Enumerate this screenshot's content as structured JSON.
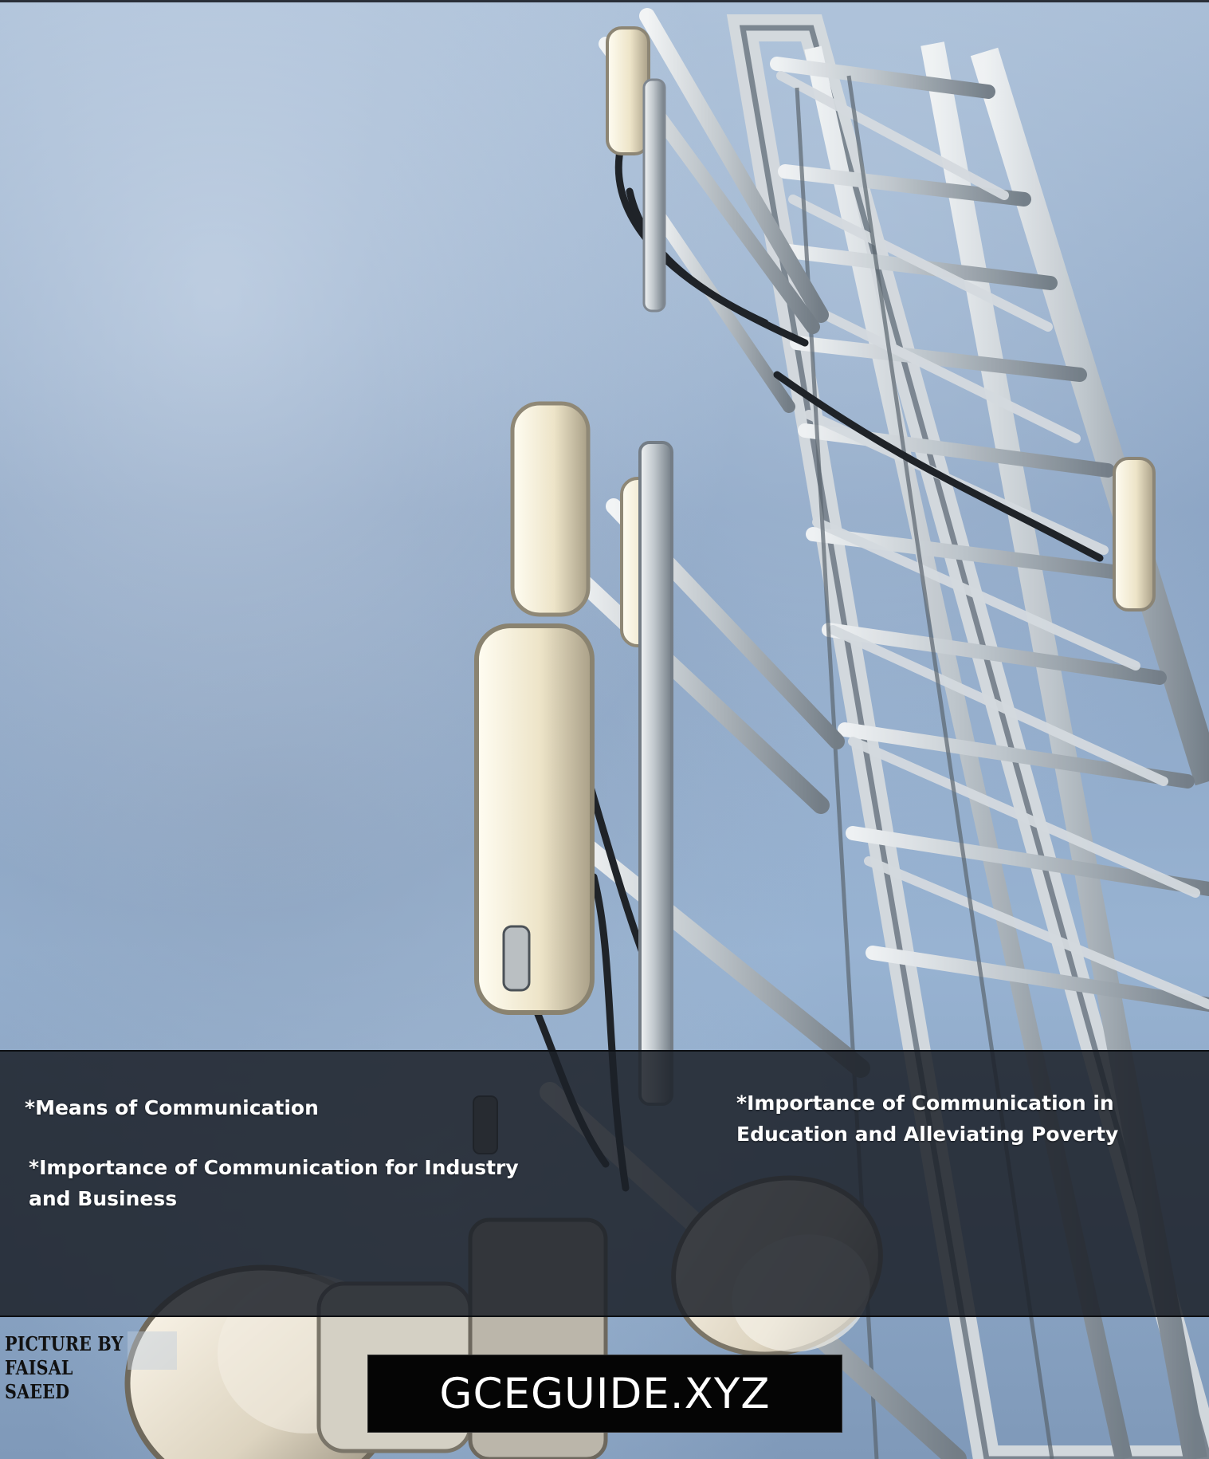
{
  "topics": {
    "means": "*Means of Communication",
    "industry": "*Importance of Communication for Industry and Business",
    "education": "*Importance of Communication in Education and Alleviating Poverty"
  },
  "credit": {
    "line1": "PICTURE BY",
    "line2": "FAISAL SAEED"
  },
  "brand": {
    "name": "GCEGUIDE.XYZ"
  },
  "photo": {
    "subject": "telecommunication-tower",
    "colors": {
      "sky": "#8fa9c8",
      "steel": "#c8ced4",
      "antenna": "#e9e1c8",
      "band": "#1c2129"
    }
  }
}
